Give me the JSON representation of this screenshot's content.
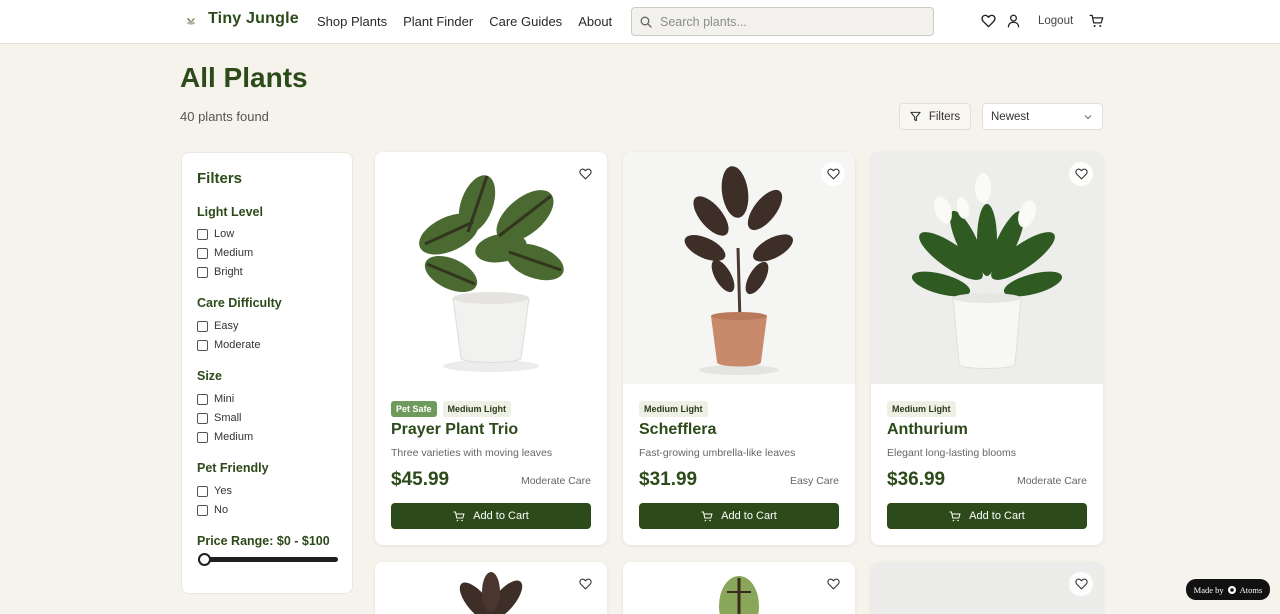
{
  "header": {
    "brand": "Tiny Jungle",
    "nav": [
      "Shop Plants",
      "Plant Finder",
      "Care Guides",
      "About"
    ],
    "search_placeholder": "Search plants...",
    "logout": "Logout"
  },
  "page": {
    "title": "All Plants",
    "count": "40 plants found",
    "filters_button": "Filters",
    "sort_value": "Newest"
  },
  "filters": {
    "title": "Filters",
    "groups": [
      {
        "heading": "Light Level",
        "options": [
          "Low",
          "Medium",
          "Bright"
        ]
      },
      {
        "heading": "Care Difficulty",
        "options": [
          "Easy",
          "Moderate"
        ]
      },
      {
        "heading": "Size",
        "options": [
          "Mini",
          "Small",
          "Medium"
        ]
      },
      {
        "heading": "Pet Friendly",
        "options": [
          "Yes",
          "No"
        ]
      }
    ],
    "price_label": "Price Range: $0 - $100",
    "price_min": 0,
    "price_max": 100
  },
  "products": [
    {
      "name": "Prayer Plant Trio",
      "desc": "Three varieties with moving leaves",
      "price": "$45.99",
      "care": "Moderate Care",
      "badges": [
        "Pet Safe",
        "Medium Light"
      ],
      "button": "Add to Cart"
    },
    {
      "name": "Schefflera",
      "desc": "Fast-growing umbrella-like leaves",
      "price": "$31.99",
      "care": "Easy Care",
      "badges": [
        "Medium Light"
      ],
      "button": "Add to Cart"
    },
    {
      "name": "Anthurium",
      "desc": "Elegant long-lasting blooms",
      "price": "$36.99",
      "care": "Moderate Care",
      "badges": [
        "Medium Light"
      ],
      "button": "Add to Cart"
    }
  ],
  "footer_badge": {
    "made_by": "Made by",
    "brand": "Atoms"
  },
  "colors": {
    "brand_green": "#2c4a1a",
    "pet_badge": "#6e9a5c",
    "background": "#f6f3ec"
  }
}
